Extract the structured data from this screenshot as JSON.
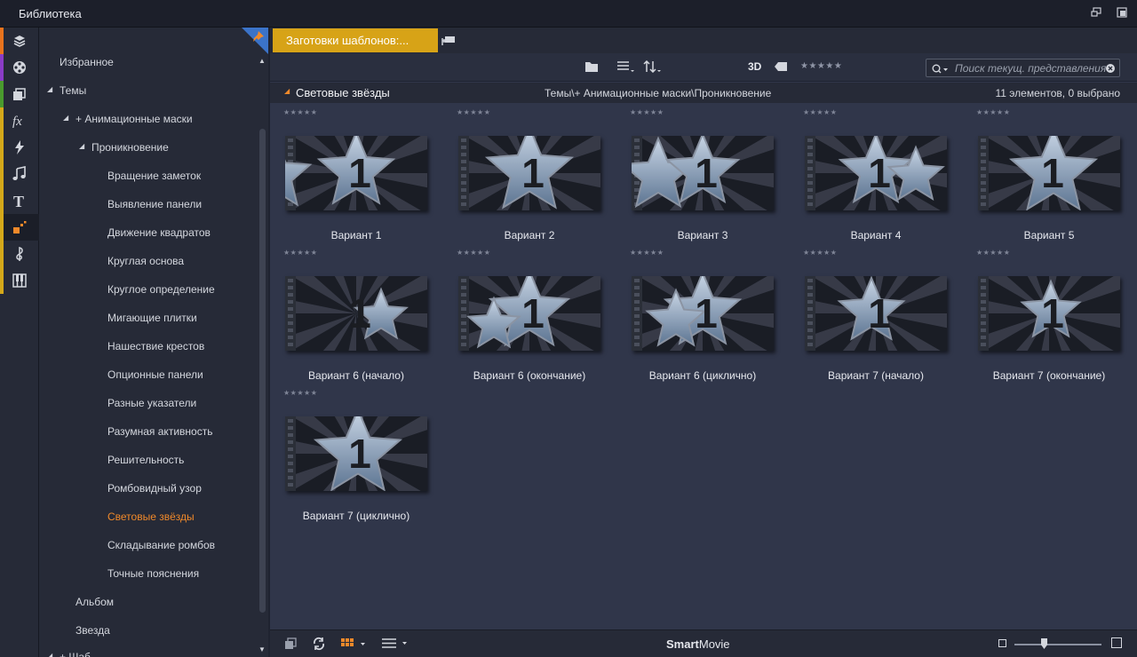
{
  "window": {
    "title": "Библиотека"
  },
  "rail": {
    "items": [
      {
        "icon": "media-import-icon",
        "stripe": "#e8731d"
      },
      {
        "icon": "film-reel-icon",
        "stripe": "#8a3cc6"
      },
      {
        "icon": "stacked-projects-icon",
        "stripe": "#4a9a2e"
      },
      {
        "icon": "fx-icon",
        "stripe": "#d4a81a"
      },
      {
        "icon": "transition-bolt-icon",
        "stripe": "#d4a81a"
      },
      {
        "icon": "music-note-icon",
        "stripe": "#d4a81a"
      },
      {
        "icon": "title-text-icon",
        "stripe": "#d4a81a"
      },
      {
        "icon": "montage-icon",
        "stripe": "#d4a81a"
      },
      {
        "icon": "score-clef-icon",
        "stripe": "#d4a81a"
      },
      {
        "icon": "piano-keys-icon",
        "stripe": "#d4a81a"
      }
    ]
  },
  "tree": {
    "favorites": "Избранное",
    "themes": "Темы",
    "animated_masks": "+ Анимационные маски",
    "penetration": "Проникновение",
    "items": [
      "Вращение заметок",
      "Выявление панели",
      "Движение квадратов",
      "Круглая основа",
      "Круглое определение",
      "Мигающие плитки",
      "Нашествие крестов",
      "Опционные панели",
      "Разные указатели",
      "Разумная активность",
      "Решительность",
      "Ромбовидный узор",
      "Световые звёзды",
      "Складывание ромбов",
      "Точные пояснения"
    ],
    "selected": "Световые звёзды",
    "album": "Альбом",
    "star": "Звезда",
    "cut_off": "+ Шаб..."
  },
  "tab": {
    "label": "Заготовки шаблонов:..."
  },
  "toolbar": {
    "three_d": "3D",
    "search_placeholder": "Поиск текущ. представления"
  },
  "pathbar": {
    "group": "Световые звёзды",
    "path": "Темы\\+ Анимационные маски\\Проникновение",
    "count": "11 элементов, 0 выбрано"
  },
  "cards": [
    {
      "label": "Вариант 1",
      "rating": "★★★★★"
    },
    {
      "label": "Вариант 2",
      "rating": "★★★★★"
    },
    {
      "label": "Вариант 3",
      "rating": "★★★★★"
    },
    {
      "label": "Вариант 4",
      "rating": "★★★★★"
    },
    {
      "label": "Вариант 5",
      "rating": "★★★★★"
    },
    {
      "label": "Вариант 6 (начало)",
      "rating": "★★★★★"
    },
    {
      "label": "Вариант 6 (окончание)",
      "rating": "★★★★★"
    },
    {
      "label": "Вариант 6 (циклично)",
      "rating": "★★★★★"
    },
    {
      "label": "Вариант 7 (начало)",
      "rating": "★★★★★"
    },
    {
      "label": "Вариант 7 (окончание)",
      "rating": "★★★★★"
    },
    {
      "label": "Вариант 7 (циклично)",
      "rating": "★★★★★"
    }
  ],
  "thumbnail_number": "1",
  "statusbar": {
    "brand_bold": "Smart",
    "brand_rest": "Movie"
  },
  "colors": {
    "accent": "#f0892a",
    "tab": "#d7a317",
    "panel": "#30364a"
  }
}
